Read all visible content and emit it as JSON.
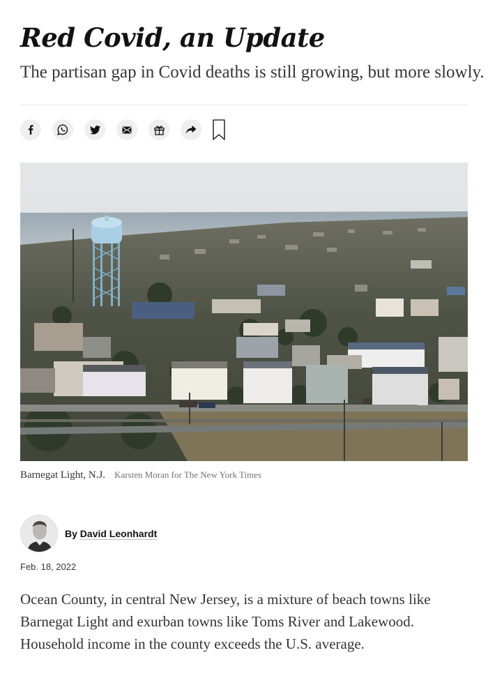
{
  "article": {
    "headline": "Red Covid, an Update",
    "summary": "The partisan gap in Covid deaths is still growing, but more slowly.",
    "share_icons": [
      "facebook-icon",
      "whatsapp-icon",
      "twitter-icon",
      "email-icon",
      "gift-icon",
      "share-icon",
      "bookmark-icon"
    ],
    "photo": {
      "caption": "Barnegat Light, N.J.",
      "credit": "Karsten Moran for The New York Times"
    },
    "byline": {
      "prefix": "By",
      "author": "David Leonhardt"
    },
    "date": "Feb. 18, 2022",
    "body": "Ocean County, in central New Jersey, is a mixture of beach towns like Barnegat Light and exurban towns like Toms River and Lakewood. Household income in the county exceeds the U.S. average."
  }
}
